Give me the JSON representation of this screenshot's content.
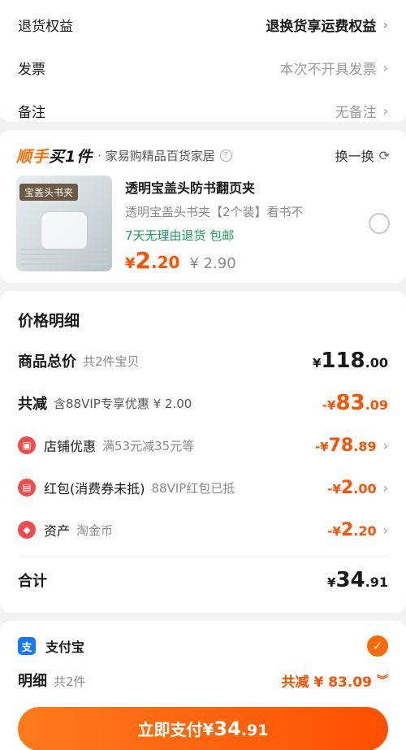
{
  "top": {
    "rows": [
      {
        "label": "退货权益",
        "value": "退换货享运费权益"
      },
      {
        "label": "发票",
        "value": "本次不开具发票"
      },
      {
        "label": "备注",
        "value": "无备注"
      }
    ]
  },
  "shop": {
    "logo_part1": "顺手",
    "logo_part2": "买1件",
    "name": "· 家易购精品百货家居",
    "swap_label": "换一换"
  },
  "product": {
    "thumb_tag": "宝盖头书夹",
    "title": "透明宝盖头防书翻页夹",
    "spec": "透明宝盖头书夹【2个装】看书不",
    "tags": "7天无理由退货  包邮",
    "price_currency": "¥",
    "price_int": "2",
    "price_dec": ".20",
    "original_price": "¥ 2.90"
  },
  "detail": {
    "title": "价格明细",
    "total_label": "商品总价",
    "total_sub": "共2件宝贝",
    "total_cur": "¥",
    "total_int": "118",
    "total_dec": ".00",
    "discount_label": "共减",
    "discount_sub": "含88VIP专享优惠 ¥ 2.00",
    "discount_cur": "-¥",
    "discount_int": "83",
    "discount_dec": ".09",
    "items": [
      {
        "label": "店铺优惠",
        "sub": "满53元减35元等",
        "cur": "-¥",
        "int": "78",
        "dec": ".89"
      },
      {
        "label": "红包(消费券未抵)",
        "sub": "88VIP红包已抵",
        "cur": "-¥",
        "int": "2",
        "dec": ".00"
      },
      {
        "label": "资产",
        "sub": "淘金币",
        "cur": "-¥",
        "int": "2",
        "dec": ".20"
      }
    ],
    "sum_label": "合计",
    "sum_cur": "¥",
    "sum_int": "34",
    "sum_dec": ".91"
  },
  "pay": {
    "method": "支付宝",
    "method_icon": "支",
    "summary_label": "明细",
    "summary_sub": "共2件",
    "saved": "共减 ¥ 83.09",
    "button_text": "立即支付",
    "button_cur": "¥",
    "button_int": "34",
    "button_dec": ".91"
  },
  "colors": {
    "accent": "#ff5000",
    "green": "#1aa05a",
    "alipay": "#1677ff"
  }
}
